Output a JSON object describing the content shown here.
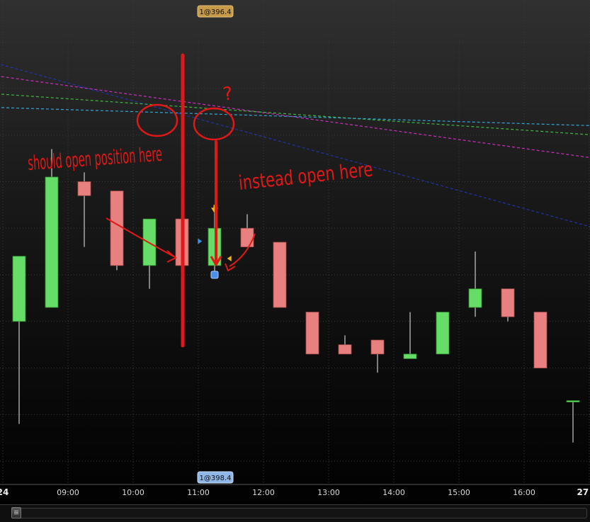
{
  "chart_data": {
    "type": "candlestick",
    "price_range": [
      388.5,
      398.9
    ],
    "x_axis": {
      "ticks": [
        {
          "label": "24",
          "bold": true,
          "slot": -0.5
        },
        {
          "label": "09:00",
          "bold": false,
          "slot": 1.5
        },
        {
          "label": "10:00",
          "bold": false,
          "slot": 3.5
        },
        {
          "label": "11:00",
          "bold": false,
          "slot": 5.5
        },
        {
          "label": "12:00",
          "bold": false,
          "slot": 7.5
        },
        {
          "label": "13:00",
          "bold": false,
          "slot": 9.5
        },
        {
          "label": "14:00",
          "bold": false,
          "slot": 11.5
        },
        {
          "label": "15:00",
          "bold": false,
          "slot": 13.5
        },
        {
          "label": "16:00",
          "bold": false,
          "slot": 15.5
        },
        {
          "label": "27",
          "bold": true,
          "slot": 17.3
        }
      ]
    },
    "candles": [
      {
        "open": 392.0,
        "high": 392.0,
        "low": 389.8,
        "close": 393.4
      },
      {
        "open": 392.3,
        "high": 395.7,
        "low": 392.3,
        "close": 395.1
      },
      {
        "open": 395.0,
        "high": 395.2,
        "low": 393.6,
        "close": 394.7
      },
      {
        "open": 394.8,
        "high": 394.8,
        "low": 393.1,
        "close": 393.2
      },
      {
        "open": 393.2,
        "high": 394.2,
        "low": 392.7,
        "close": 394.2
      },
      {
        "open": 394.2,
        "high": 394.2,
        "low": 393.2,
        "close": 393.2
      },
      {
        "open": 393.2,
        "high": 394.4,
        "low": 393.0,
        "close": 394.0
      },
      {
        "open": 394.0,
        "high": 394.3,
        "low": 393.6,
        "close": 393.6
      },
      {
        "open": 393.7,
        "high": 393.7,
        "low": 392.3,
        "close": 392.3
      },
      {
        "open": 392.2,
        "high": 392.2,
        "low": 391.3,
        "close": 391.3
      },
      {
        "open": 391.5,
        "high": 391.7,
        "low": 391.3,
        "close": 391.3
      },
      {
        "open": 391.6,
        "high": 391.6,
        "low": 390.9,
        "close": 391.3
      },
      {
        "open": 391.2,
        "high": 392.2,
        "low": 391.2,
        "close": 391.3
      },
      {
        "open": 391.3,
        "high": 392.2,
        "low": 391.3,
        "close": 392.2
      },
      {
        "open": 392.3,
        "high": 393.5,
        "low": 392.1,
        "close": 392.7
      },
      {
        "open": 392.7,
        "high": 392.7,
        "low": 392.0,
        "close": 392.1
      },
      {
        "open": 392.2,
        "high": 392.2,
        "low": 391.0,
        "close": 391.0
      },
      {
        "open": 390.3,
        "high": 390.3,
        "low": 389.4,
        "close": 390.3
      }
    ],
    "indicator_lines": [
      {
        "color": "#2233aa",
        "points": [
          [
            -1.0,
            397.6
          ],
          [
            17.7,
            394.0
          ]
        ]
      },
      {
        "color": "#cc2fc0",
        "points": [
          [
            -1.0,
            397.3
          ],
          [
            17.7,
            395.5
          ]
        ]
      },
      {
        "color": "#3fb83f",
        "points": [
          [
            -1.0,
            396.9
          ],
          [
            17.7,
            396.0
          ]
        ]
      },
      {
        "color": "#30a8d8",
        "points": [
          [
            -1.0,
            396.6
          ],
          [
            17.7,
            396.2
          ]
        ]
      }
    ],
    "trade_markers": [
      {
        "kind": "entry-arrow",
        "slot": 6.0,
        "price": 394.35,
        "color": "#f0b429"
      },
      {
        "kind": "right-triangle",
        "slot": 5.55,
        "price": 393.72,
        "color": "#3a8fe8"
      },
      {
        "kind": "left-triangle",
        "slot": 6.45,
        "price": 393.35,
        "color": "#f0b429"
      },
      {
        "kind": "square",
        "slot": 6.0,
        "price": 393.0,
        "color": "#4a8fe8"
      }
    ],
    "price_tags": {
      "top": "1@396.4",
      "bottom": "1@398.4"
    },
    "annotations": {
      "should_open": "should open position here",
      "instead_open": "instead open here",
      "question_mark": "?",
      "color": "#e01818"
    },
    "colors": {
      "bull": "#66dd66",
      "bear": "#e88080",
      "wick": "#f0f0f0",
      "grid": "#3a3a3a"
    }
  }
}
